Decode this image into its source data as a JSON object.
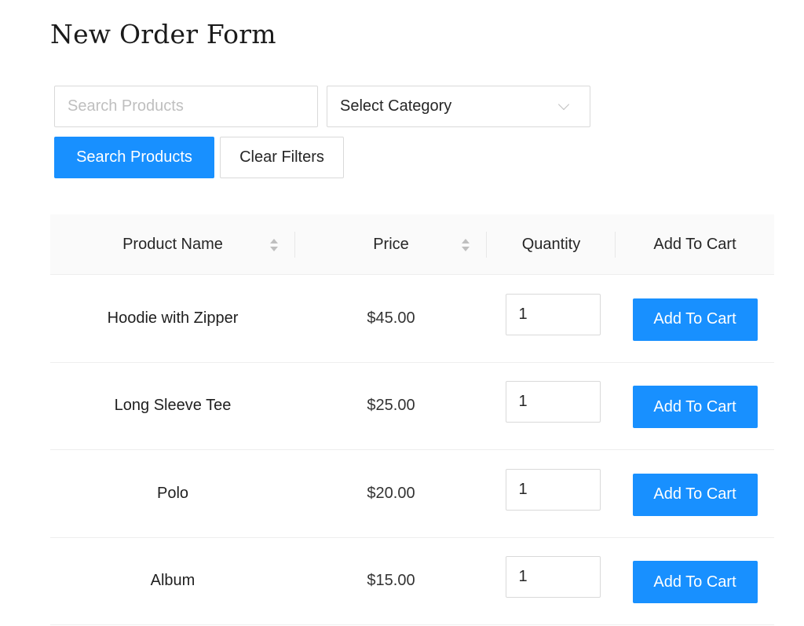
{
  "page": {
    "title": "New Order Form"
  },
  "filters": {
    "search_placeholder": "Search Products",
    "search_value": "",
    "category_selected": "Select Category",
    "search_button_label": "Search Products",
    "clear_button_label": "Clear Filters"
  },
  "colors": {
    "primary": "#1890ff",
    "border": "#d9d9d9",
    "header_bg": "#fafafa"
  },
  "table": {
    "columns": [
      {
        "label": "Product Name",
        "sortable": true
      },
      {
        "label": "Price",
        "sortable": true
      },
      {
        "label": "Quantity",
        "sortable": false
      },
      {
        "label": "Add To Cart",
        "sortable": false
      }
    ],
    "rows": [
      {
        "name": "Hoodie with Zipper",
        "price": "$45.00",
        "quantity": "1",
        "action_label": "Add To Cart"
      },
      {
        "name": "Long Sleeve Tee",
        "price": "$25.00",
        "quantity": "1",
        "action_label": "Add To Cart"
      },
      {
        "name": "Polo",
        "price": "$20.00",
        "quantity": "1",
        "action_label": "Add To Cart"
      },
      {
        "name": "Album",
        "price": "$15.00",
        "quantity": "1",
        "action_label": "Add To Cart"
      }
    ]
  }
}
